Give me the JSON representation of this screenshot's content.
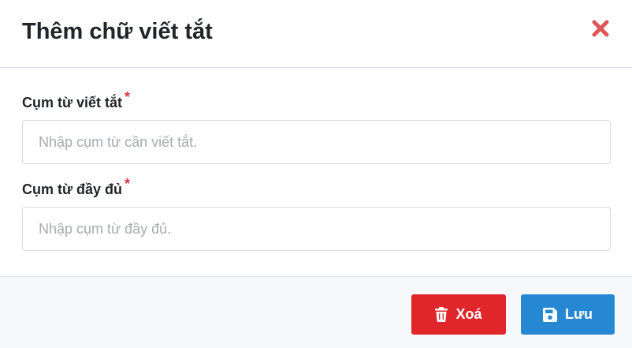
{
  "modal": {
    "title": "Thêm chữ viết tắt",
    "close_icon": "close-icon"
  },
  "form": {
    "abbreviation": {
      "label": "Cụm từ viết tắt",
      "required_mark": "*",
      "value": "",
      "placeholder": "Nhập cụm từ cần viết tắt."
    },
    "full_phrase": {
      "label": "Cụm từ đầy đủ",
      "required_mark": "*",
      "value": "",
      "placeholder": "Nhập cụm từ đầy đủ."
    }
  },
  "footer": {
    "delete_label": "Xoá",
    "delete_icon": "trash-icon",
    "save_label": "Lưu",
    "save_icon": "floppy-disk-icon"
  },
  "colors": {
    "close": "#e05555",
    "required": "#dc3545",
    "delete_button": "#e0262b",
    "save_button": "#2688d3",
    "footer_background": "#f7f8fa"
  }
}
